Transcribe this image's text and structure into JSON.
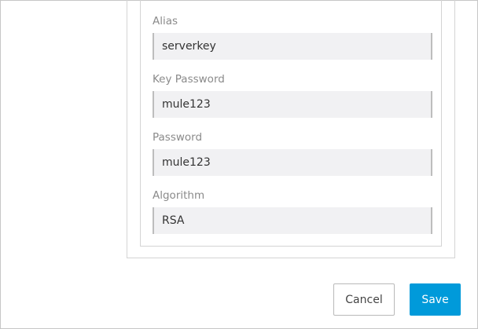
{
  "form": {
    "fields": [
      {
        "label": "Alias",
        "value": "serverkey"
      },
      {
        "label": "Key Password",
        "value": "mule123"
      },
      {
        "label": "Password",
        "value": "mule123"
      },
      {
        "label": "Algorithm",
        "value": "RSA"
      }
    ]
  },
  "actions": {
    "cancel_label": "Cancel",
    "save_label": "Save"
  },
  "colors": {
    "primary": "#009ada",
    "input_background": "#f1f1f3",
    "label": "#8a8a8a"
  }
}
